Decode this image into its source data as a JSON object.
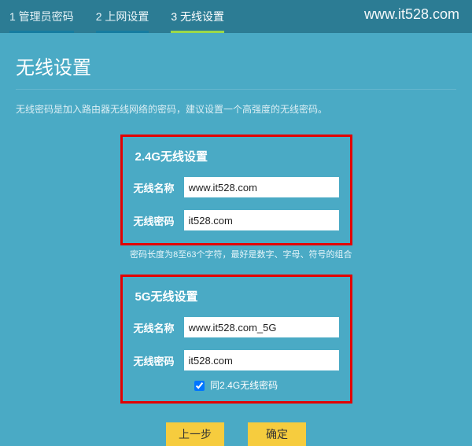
{
  "watermark": "www.it528.com",
  "steps": {
    "s1": "1 管理员密码",
    "s2": "2 上网设置",
    "s3": "3 无线设置"
  },
  "page": {
    "title": "无线设置",
    "desc": "无线密码是加入路由器无线网络的密码，建议设置一个高强度的无线密码。"
  },
  "section24": {
    "title": "2.4G无线设置",
    "name_label": "无线名称",
    "name_value": "www.it528.com",
    "pwd_label": "无线密码",
    "pwd_value": "it528.com"
  },
  "hint": "密码长度为8至63个字符，最好是数字、字母、符号的组合",
  "section5g": {
    "title": "5G无线设置",
    "name_label": "无线名称",
    "name_value": "www.it528.com_5G",
    "pwd_label": "无线密码",
    "pwd_value": "it528.com",
    "same_label": "同2.4G无线密码"
  },
  "buttons": {
    "prev": "上一步",
    "ok": "确定"
  }
}
